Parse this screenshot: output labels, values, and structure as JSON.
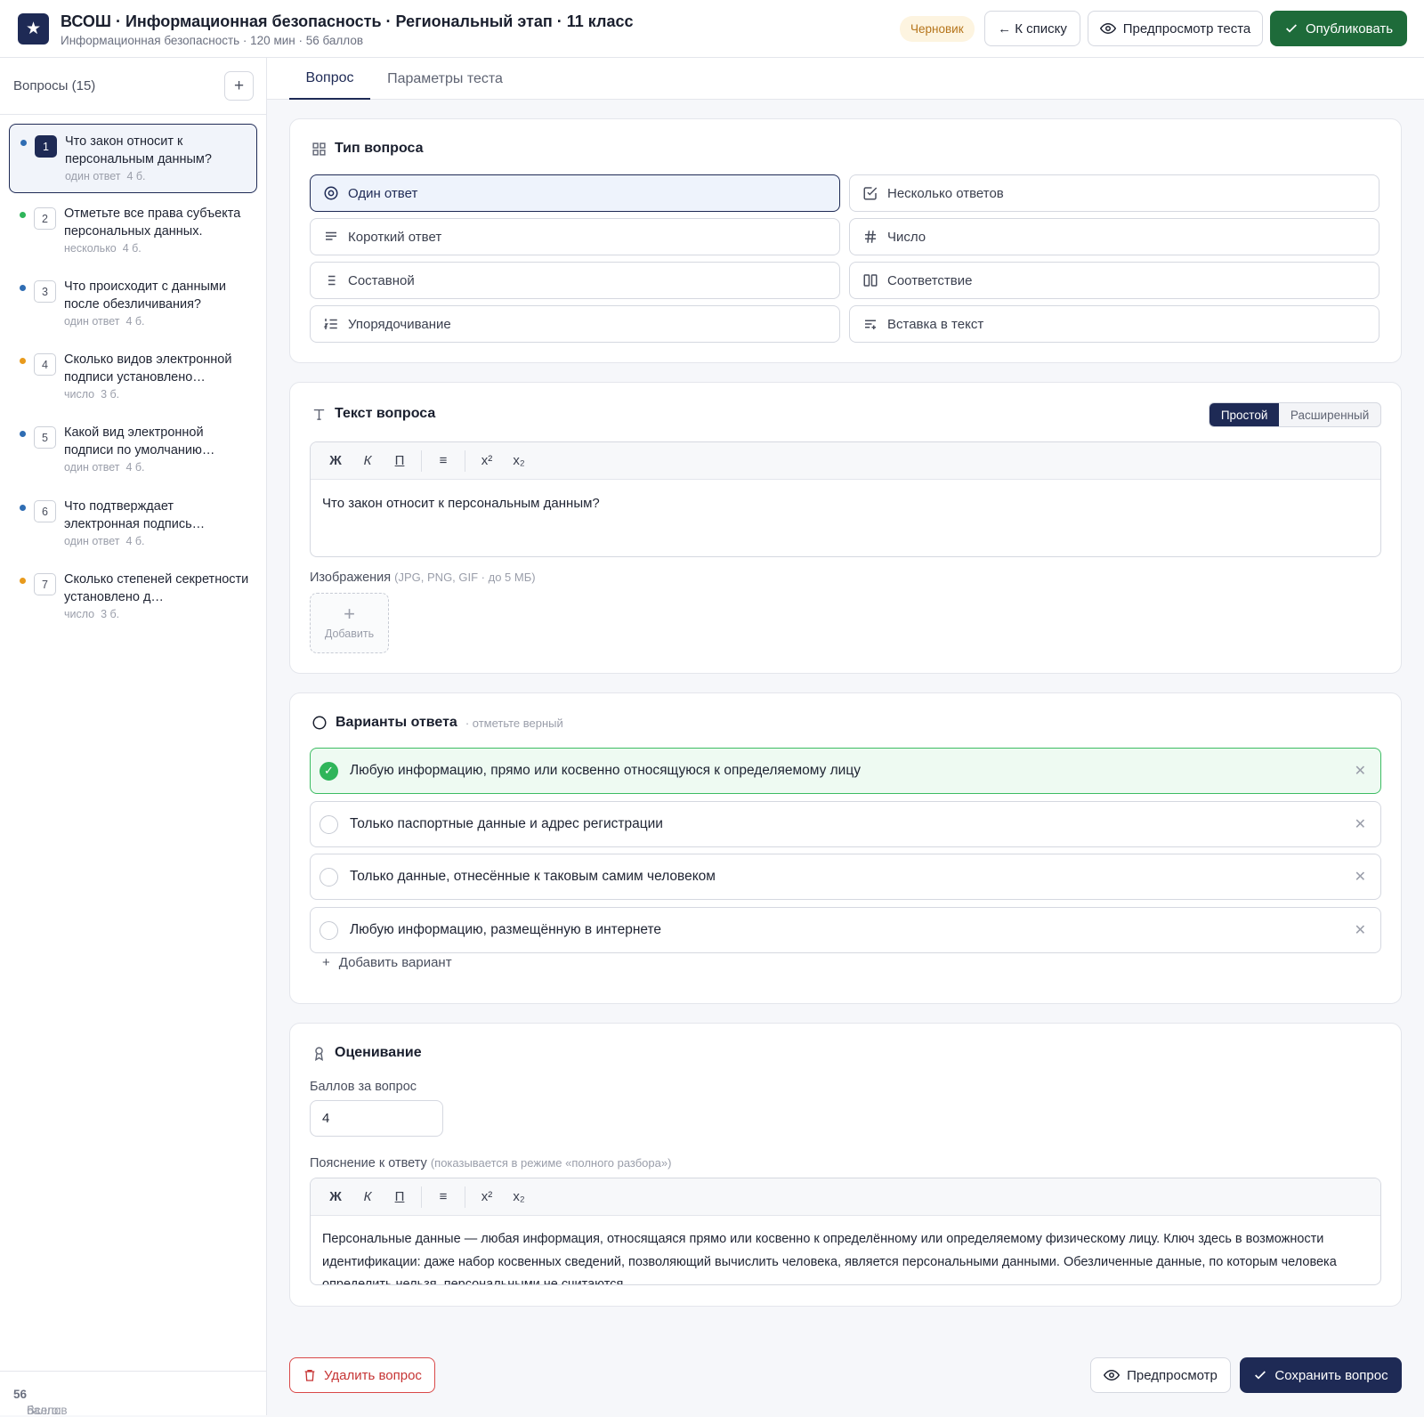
{
  "header": {
    "logo_glyph": "★",
    "title": "ВСОШ · Информационная безопасность · Региональный этап · 11 класс",
    "subtitle": "Информационная безопасность · 120 мин · 56 баллов",
    "status": "Черновик",
    "back_label": "← К списку",
    "preview_test_label": "Предпросмотр теста",
    "publish_label": "Опубликовать"
  },
  "sidebar": {
    "title": "Вопросы (15)",
    "add_icon": "plus-icon",
    "items": [
      {
        "num": "1",
        "text": "Что закон относит к персональным данным?",
        "type": "один ответ",
        "points": "4 б.",
        "dot": "#2f6db3"
      },
      {
        "num": "2",
        "text": "Отметьте все права субъекта персональных данных.",
        "type": "несколько",
        "points": "4 б.",
        "dot": "#2fb55a"
      },
      {
        "num": "3",
        "text": "Что происходит с данными после обезличивания?",
        "type": "один ответ",
        "points": "4 б.",
        "dot": "#2f6db3"
      },
      {
        "num": "4",
        "text": "Сколько видов электронной подписи установлено…",
        "type": "число",
        "points": "3 б.",
        "dot": "#e89a1c"
      },
      {
        "num": "5",
        "text": "Какой вид электронной подписи по умолчанию…",
        "type": "один ответ",
        "points": "4 б.",
        "dot": "#2f6db3"
      },
      {
        "num": "6",
        "text": "Что подтверждает электронная подпись…",
        "type": "один ответ",
        "points": "4 б.",
        "dot": "#2f6db3"
      },
      {
        "num": "7",
        "text": "Сколько степеней секретности установлено д…",
        "type": "число",
        "points": "3 б.",
        "dot": "#e89a1c"
      }
    ],
    "footer_prefix": "Всего: ",
    "footer_value": "56",
    "footer_suffix": " баллов"
  },
  "tabs": {
    "question": "Вопрос",
    "settings": "Параметры теста"
  },
  "question_type": {
    "title": "Тип вопроса",
    "options": [
      {
        "label": "Один ответ",
        "icon": "radio-target-icon"
      },
      {
        "label": "Несколько ответов",
        "icon": "checkbox-icon"
      },
      {
        "label": "Короткий ответ",
        "icon": "text-lines-icon"
      },
      {
        "label": "Число",
        "icon": "hash-icon"
      },
      {
        "label": "Составной",
        "icon": "list-icon"
      },
      {
        "label": "Соответствие",
        "icon": "columns-icon"
      },
      {
        "label": "Упорядочивание",
        "icon": "ordered-list-icon"
      },
      {
        "label": "Вставка в текст",
        "icon": "insert-text-icon"
      }
    ],
    "selected": "Один ответ"
  },
  "question_text": {
    "title": "Текст вопроса",
    "mode_simple": "Простой",
    "mode_advanced": "Расширенный",
    "toolbar": {
      "bold": "Ж",
      "italic": "К",
      "underline": "П",
      "list": "≡",
      "sup": "x²",
      "sub": "x₂"
    },
    "content": "Что закон относит к персональным данным?",
    "images_label": "Изображения",
    "images_hint": "(JPG, PNG, GIF · до 5 МБ)",
    "add_image_label": "Добавить"
  },
  "answers": {
    "title": "Варианты ответа",
    "hint": "· отметьте верный",
    "items": [
      {
        "text": "Любую информацию, прямо или косвенно относящуюся к определяемому лицу",
        "correct": true
      },
      {
        "text": "Только паспортные данные и адрес регистрации",
        "correct": false
      },
      {
        "text": "Только данные, отнесённые к таковым самим человеком",
        "correct": false
      },
      {
        "text": "Любую информацию, размещённую в интернете",
        "correct": false
      }
    ],
    "add_label": "Добавить вариант"
  },
  "grading": {
    "title": "Оценивание",
    "points_label": "Баллов за вопрос",
    "points_value": "4",
    "explanation_label": "Пояснение к ответу",
    "explanation_hint": "(показывается в режиме «полного разбора»)",
    "explanation": "Персональные данные — любая информация, относящаяся прямо или косвенно к определённому или определяемому физическому лицу. Ключ здесь в возможности идентификации: даже набор косвенных сведений, позволяющий вычислить человека, является персональными данными. Обезличенные данные, по которым человека определить нельзя, персональными не считаются."
  },
  "footer": {
    "delete_label": "Удалить вопрос",
    "preview_label": "Предпросмотр",
    "save_label": "Сохранить вопрос"
  },
  "colors": {
    "brand": "#1e2a55",
    "publish": "#1e6b3a",
    "correct": "#2fb55a",
    "danger": "#c63434",
    "draft_badge": "#b5741a"
  }
}
